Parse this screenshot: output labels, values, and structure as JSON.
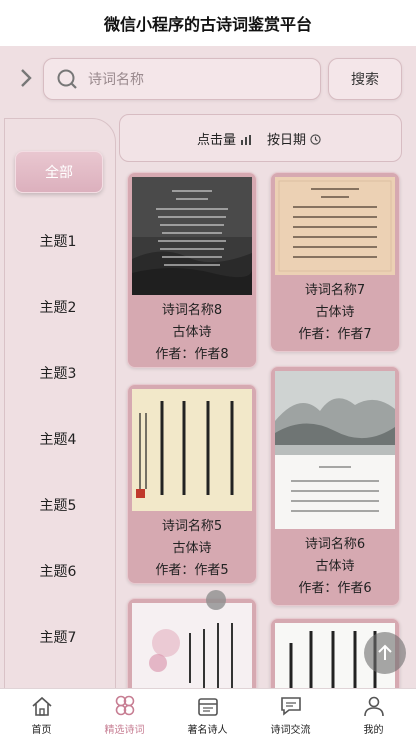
{
  "app": {
    "title": "微信小程序的古诗词鉴赏平台"
  },
  "search": {
    "placeholder": "诗词名称",
    "button": "搜索"
  },
  "sidebar": {
    "all_label": "全部",
    "themes": [
      "主题1",
      "主题2",
      "主题3",
      "主题4",
      "主题5",
      "主题6",
      "主题7"
    ]
  },
  "sort": {
    "by_clicks": "点击量",
    "by_date": "按日期"
  },
  "poems": [
    {
      "name": "诗词名称8",
      "type": "古体诗",
      "author": "作者：作者8"
    },
    {
      "name": "诗词名称7",
      "type": "古体诗",
      "author": "作者：作者7"
    },
    {
      "name": "诗词名称5",
      "type": "古体诗",
      "author": "作者：作者5"
    },
    {
      "name": "诗词名称6",
      "type": "古体诗",
      "author": "作者：作者6"
    }
  ],
  "tabs": [
    {
      "label": "首页",
      "icon": "home-icon"
    },
    {
      "label": "精选诗词",
      "icon": "clover-icon"
    },
    {
      "label": "著名诗人",
      "icon": "calendar-icon"
    },
    {
      "label": "诗词交流",
      "icon": "chat-icon"
    },
    {
      "label": "我的",
      "icon": "user-icon"
    }
  ],
  "colors": {
    "accent": "#c77e93",
    "card_bg": "#d6a9b1",
    "page_bg": "#eedfe2"
  }
}
